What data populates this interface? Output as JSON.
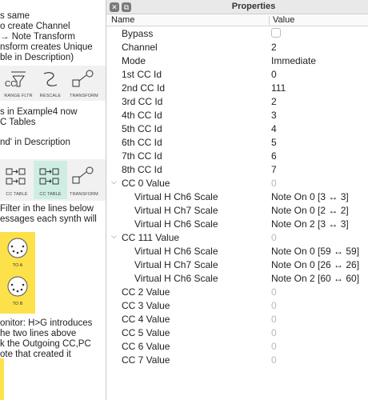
{
  "left_panel": {
    "text_lines": [
      "s same",
      "o create Channel",
      " → Note Transform",
      "nsform creates Unique",
      "ble in Description)"
    ],
    "tiles_row1": [
      "RANGE FLTR",
      "RESCALE",
      "TRANSFORM"
    ],
    "tiles_row1_first_symbol": "CC",
    "mid_lines": [
      "s in Example4 now",
      "C Tables",
      "",
      "nd' in Description"
    ],
    "tiles_row2": [
      "CC TABLE",
      "CC TABLE",
      "TRANSFORM"
    ],
    "lower_lines": [
      "Filter in the lines below",
      "essages each synth will"
    ],
    "midi_ports": [
      "TO A",
      "TO B"
    ],
    "bottom_lines": [
      "onitor: H>G introduces",
      "he two lines above",
      "k the Outgoing CC,PC",
      "ote that created it"
    ]
  },
  "properties": {
    "title": "Properties",
    "columns": {
      "name": "Name",
      "value": "Value"
    },
    "rows": [
      {
        "name": "Bypass",
        "type": "checkbox",
        "checked": false,
        "level": 0
      },
      {
        "name": "Channel",
        "value": "2",
        "level": 0
      },
      {
        "name": "Mode",
        "value": "Immediate",
        "level": 0
      },
      {
        "name": "1st CC Id",
        "value": "0",
        "level": 0
      },
      {
        "name": "2nd CC Id",
        "value": "111",
        "level": 0
      },
      {
        "name": "3rd CC Id",
        "value": "2",
        "level": 0
      },
      {
        "name": "4th CC Id",
        "value": "3",
        "level": 0
      },
      {
        "name": "5th CC Id",
        "value": "4",
        "level": 0
      },
      {
        "name": "6th CC Id",
        "value": "5",
        "level": 0
      },
      {
        "name": "7th CC Id",
        "value": "6",
        "level": 0
      },
      {
        "name": "8th CC Id",
        "value": "7",
        "level": 0
      },
      {
        "name": "CC 0 Value",
        "value": "0",
        "dim": true,
        "expanded": true,
        "level": 0
      },
      {
        "name": "Virtual H Ch6 Scale",
        "value": "Note On 0 [3 ↔ 3]",
        "level": 1
      },
      {
        "name": "Virtual H Ch7 Scale",
        "value": "Note On 0 [2 ↔ 2]",
        "level": 1
      },
      {
        "name": "Virtual H Ch6 Scale",
        "value": "Note On 2 [3 ↔ 3]",
        "level": 1
      },
      {
        "name": "CC 111 Value",
        "value": "0",
        "dim": true,
        "expanded": true,
        "level": 0
      },
      {
        "name": "Virtual H Ch6 Scale",
        "value": "Note On 0 [59 ↔ 59]",
        "level": 1
      },
      {
        "name": "Virtual H Ch7 Scale",
        "value": "Note On 0 [26 ↔ 26]",
        "level": 1
      },
      {
        "name": "Virtual H Ch6 Scale",
        "value": "Note On 2 [60 ↔ 60]",
        "level": 1
      },
      {
        "name": "CC 2 Value",
        "value": "0",
        "dim": true,
        "level": 0
      },
      {
        "name": "CC 3 Value",
        "value": "0",
        "dim": true,
        "level": 0
      },
      {
        "name": "CC 4 Value",
        "value": "0",
        "dim": true,
        "level": 0
      },
      {
        "name": "CC 5 Value",
        "value": "0",
        "dim": true,
        "level": 0
      },
      {
        "name": "CC 6 Value",
        "value": "0",
        "dim": true,
        "level": 0
      },
      {
        "name": "CC 7 Value",
        "value": "0",
        "dim": true,
        "level": 0
      }
    ]
  },
  "icons": {
    "titlebar": [
      "close-icon",
      "detach-icon"
    ],
    "expander": "chevron-down-icon"
  },
  "colors": {
    "accent_yellow": "#fde14a",
    "selected_tile": "#cfeee3",
    "dim_value": "#b8b8b8"
  }
}
